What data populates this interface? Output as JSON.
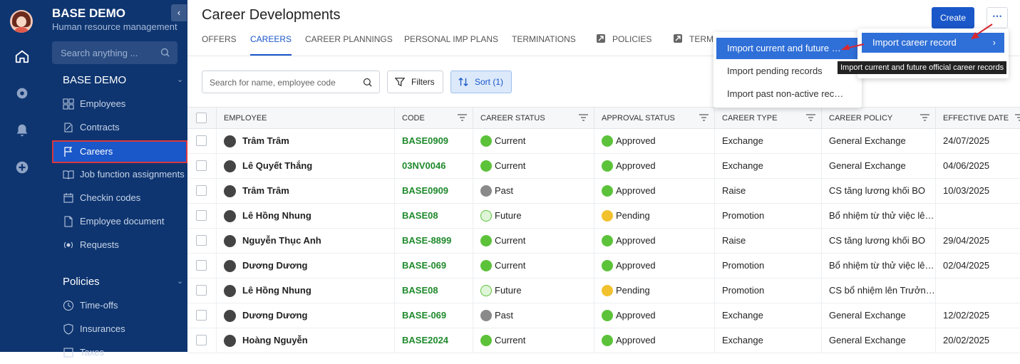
{
  "sidebar": {
    "org_title": "BASE DEMO",
    "org_subtitle": "Human resource management",
    "collapse_icon": "‹",
    "search_placeholder": "Search anything ...",
    "group1": "BASE DEMO",
    "items1": [
      "Employees",
      "Contracts",
      "Careers",
      "Job function assignments",
      "Checkin codes",
      "Employee document",
      "Requests"
    ],
    "group2": "Policies",
    "items2": [
      "Time-offs",
      "Insurances",
      "Taxes"
    ]
  },
  "header": {
    "title": "Career Developments",
    "create_label": "Create",
    "more_label": "⋯",
    "tabs": [
      "OFFERS",
      "CAREERS",
      "CAREER PLANNINGS",
      "PERSONAL IMP PLANS",
      "TERMINATIONS",
      "POLICIES",
      "TERM"
    ]
  },
  "toolbar": {
    "search_placeholder": "Search for name, employee code",
    "filters_label": "Filters",
    "sort_label": "Sort (1)"
  },
  "table": {
    "columns": [
      "EMPLOYEE",
      "CODE",
      "CAREER STATUS",
      "APPROVAL STATUS",
      "CAREER TYPE",
      "CAREER POLICY",
      "EFFECTIVE DATE"
    ],
    "rows": [
      {
        "employee": "Trâm Trâm",
        "code": "BASE0909",
        "career_status": "Current",
        "approval": "Approved",
        "type": "Exchange",
        "policy": "General Exchange",
        "date": "24/07/2025"
      },
      {
        "employee": "Lê Quyết Thắng",
        "code": "03NV0046",
        "career_status": "Current",
        "approval": "Approved",
        "type": "Exchange",
        "policy": "General Exchange",
        "date": "04/06/2025"
      },
      {
        "employee": "Trâm Trâm",
        "code": "BASE0909",
        "career_status": "Past",
        "approval": "Approved",
        "type": "Raise",
        "policy": "CS tăng lương khối BO",
        "date": "10/03/2025"
      },
      {
        "employee": "Lê Hồng Nhung",
        "code": "BASE08",
        "career_status": "Future",
        "approval": "Pending",
        "type": "Promotion",
        "policy": "Bổ nhiệm từ thử việc lên chính thức",
        "date": ""
      },
      {
        "employee": "Nguyễn Thục Anh",
        "code": "BASE-8899",
        "career_status": "Current",
        "approval": "Approved",
        "type": "Raise",
        "policy": "CS tăng lương khối BO",
        "date": "29/04/2025"
      },
      {
        "employee": "Dương Dương",
        "code": "BASE-069",
        "career_status": "Current",
        "approval": "Approved",
        "type": "Promotion",
        "policy": "Bổ nhiệm từ thử việc lên chính thức",
        "date": "02/04/2025"
      },
      {
        "employee": "Lê Hồng Nhung",
        "code": "BASE08",
        "career_status": "Future",
        "approval": "Pending",
        "type": "Promotion",
        "policy": "CS bổ nhiệm lên Trưởng phòng",
        "date": ""
      },
      {
        "employee": "Dương Dương",
        "code": "BASE-069",
        "career_status": "Past",
        "approval": "Approved",
        "type": "Exchange",
        "policy": "General Exchange",
        "date": "12/02/2025"
      },
      {
        "employee": "Hoàng Nguyễn",
        "code": "BASE2024",
        "career_status": "Current",
        "approval": "Approved",
        "type": "Exchange",
        "policy": "General Exchange",
        "date": "20/02/2025"
      }
    ]
  },
  "status_colors": {
    "Current": "#5cc23a",
    "Past": "#8a8a8a",
    "Future": "#dff5d8",
    "Approved": "#5cc23a",
    "Pending": "#f2c12e"
  },
  "dropdown": {
    "items": [
      "Import current and future official career records",
      "Import pending records",
      "Import past non-active records"
    ],
    "submenu_label": "Import career record",
    "submenu_arrow": "›",
    "tooltip": "Import current and future official career records"
  }
}
